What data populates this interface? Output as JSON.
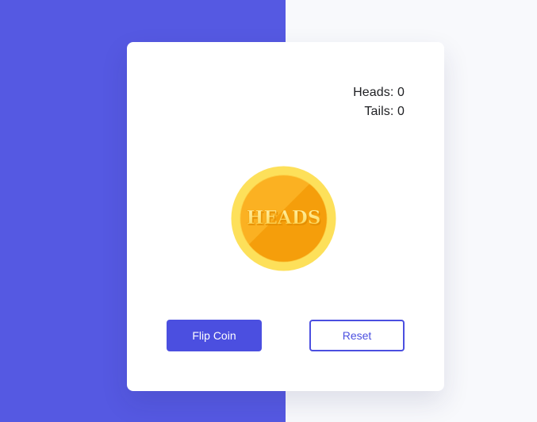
{
  "colors": {
    "accent": "#4b4fe0",
    "left_panel": "#5559e2",
    "background": "#f8f9fc",
    "card": "#ffffff",
    "coin_outer": "#fcd34d",
    "coin_inner": "#f59e0b",
    "coin_text": "#fde68a"
  },
  "score": {
    "heads_label": "Heads: 0",
    "tails_label": "Tails: 0"
  },
  "coin": {
    "face_text": "HEADS"
  },
  "buttons": {
    "flip_label": "Flip Coin",
    "reset_label": "Reset"
  }
}
